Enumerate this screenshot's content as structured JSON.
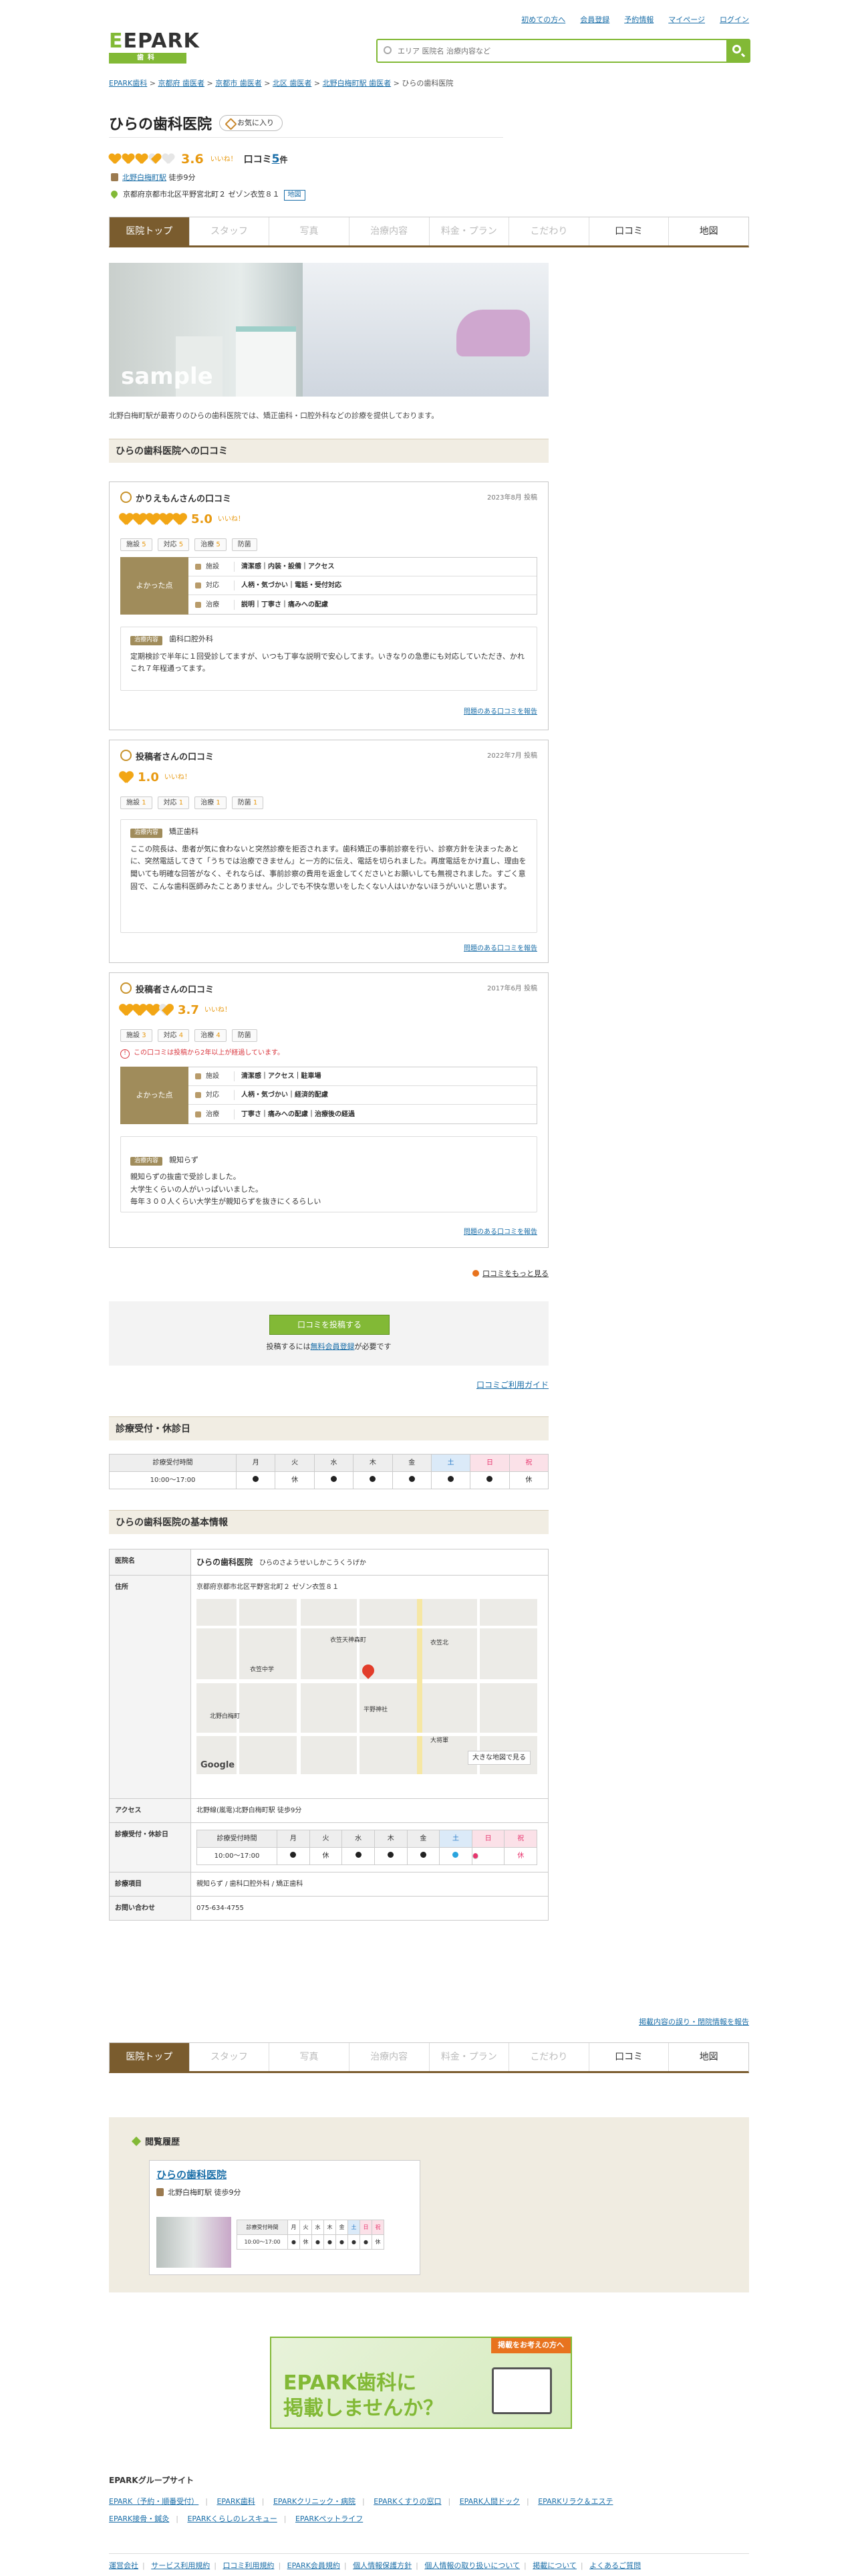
{
  "header": {
    "links": [
      "初めての方へ",
      "会員登録",
      "予約情報",
      "マイページ",
      "ログイン"
    ],
    "logo_main": "EPARK",
    "logo_sub": "歯科",
    "search_placeholder": "エリア 医院名 治療内容など"
  },
  "breadcrumb": [
    "EPARK歯科",
    "京都府 歯医者",
    "京都市 歯医者",
    "北区 歯医者",
    "北野白梅町駅 歯医者",
    "ひらの歯科医院"
  ],
  "clinic": {
    "name": "ひらの歯科医院",
    "favorite": "お気に入り",
    "rating": "3.6",
    "rating_word": "いいね！",
    "review_label": "口コミ",
    "review_count": "5",
    "review_unit": "件",
    "station": "北野白梅町駅",
    "walk": "徒歩9分",
    "address": "京都府京都市北区平野宮北町２ ゼゾン衣笠８１",
    "map_btn": "地図"
  },
  "tabs": [
    "医院トップ",
    "スタッフ",
    "写真",
    "治療内容",
    "料金・プラン",
    "こだわり",
    "口コミ",
    "地図"
  ],
  "photo_label": "sample",
  "description": "北野白梅町駅が最寄りのひらの歯科医院では、矯正歯科・口腔外科などの診療を提供しております。",
  "reviews_title": "ひらの歯科医院への口コミ",
  "reviews": [
    {
      "author": "かりえもんさんの口コミ",
      "date": "2023年8月 投稿",
      "score": "5.0",
      "word": "いいね！",
      "chips": [
        [
          "施設",
          "5"
        ],
        [
          "対応",
          "5"
        ],
        [
          "治療",
          "5"
        ],
        [
          "防菌",
          ""
        ]
      ],
      "good_label": "よかった点",
      "rows": [
        [
          "施設",
          "清潔感｜内装・設備｜アクセス"
        ],
        [
          "対応",
          "人柄・気づかい｜電話・受付対応"
        ],
        [
          "治療",
          "説明｜丁寧さ｜痛みへの配慮"
        ]
      ],
      "tag": "治療内容",
      "treat": "歯科口腔外科",
      "body": "定期検診で半年に１回受診してますが、いつも丁寧な説明で安心してます。いきなりの急患にも対応していただき、かれこれ７年程通ってます。",
      "report": "問題のある口コミを報告"
    },
    {
      "author": "投稿者さんの口コミ",
      "date": "2022年7月 投稿",
      "score": "1.0",
      "word": "いいね！",
      "chips": [
        [
          "施設",
          "1"
        ],
        [
          "対応",
          "1"
        ],
        [
          "治療",
          "1"
        ],
        [
          "防菌",
          "1"
        ]
      ],
      "tag": "治療内容",
      "treat": "矯正歯科",
      "body": "ここの院長は、患者が気に食わないと突然診療を拒否されます。歯科矯正の事前診察を行い、診察方針を決まったあとに、突然電話してきて「うちでは治療できません」と一方的に伝え、電話を切られました。再度電話をかけ直し、理由を聞いても明確な回答がなく、それならば、事前診察の費用を返金してくださいとお願いしても無視されました。すごく意固で、こんな歯科医師みたことありません。少しでも不快な思いをしたくない人はいかないほうがいいと思います。",
      "report": "問題のある口コミを報告"
    },
    {
      "author": "投稿者さんの口コミ",
      "date": "2017年6月 投稿",
      "score": "3.7",
      "word": "いいね！",
      "chips": [
        [
          "施設",
          "3"
        ],
        [
          "対応",
          "4"
        ],
        [
          "治療",
          "4"
        ],
        [
          "防菌",
          ""
        ]
      ],
      "warning": "この口コミは投稿から2年以上が経過しています。",
      "good_label": "よかった点",
      "rows": [
        [
          "施設",
          "清潔感｜アクセス｜駐車場"
        ],
        [
          "対応",
          "人柄・気づかい｜経済的配慮"
        ],
        [
          "治療",
          "丁寧さ｜痛みへの配慮｜治療後の経過"
        ]
      ],
      "tag": "治療内容",
      "treat": "親知らず",
      "body": "親知らずの抜歯で受診しました。\n大学生くらいの人がいっぱいいました。\n毎年３００人くらい大学生が親知らずを抜きにくるらしい",
      "report": "問題のある口コミを報告"
    }
  ],
  "more_reviews": "口コミをもっと見る",
  "post": {
    "button": "口コミを投稿する",
    "note_pre": "投稿するには",
    "note_link": "無料会員登録",
    "note_post": "が必要です"
  },
  "guide": "口コミご利用ガイド",
  "hours_title": "診療受付・休診日",
  "hours": {
    "head": "診療受付時間",
    "days": [
      "月",
      "火",
      "水",
      "木",
      "金",
      "土",
      "日",
      "祝"
    ],
    "time": "10:00〜17:00",
    "marks": [
      "●",
      "休",
      "●",
      "●",
      "●",
      "●",
      "●",
      "休"
    ]
  },
  "basic_title": "ひらの歯科医院の基本情報",
  "basic": {
    "k_name": "医院名",
    "name": "ひらの歯科医院",
    "kana": "ひらのさようせいしかこうくうげか",
    "k_addr": "住所",
    "addr": "京都府京都市北区平野宮北町２ ゼゾン衣笠８１",
    "map_big": "大きな地図で見る",
    "google": "Google",
    "k_access": "アクセス",
    "access": "北野線(嵐電)北野白梅町駅 徒歩9分",
    "k_hours": "診療受付・休診日",
    "k_items": "診療項目",
    "items": "親知らず / 歯科口腔外科 / 矯正歯科",
    "k_tel": "お問い合わせ",
    "tel": "075-634-4755",
    "map_labels": [
      "衣笠中学",
      "北野白梅町",
      "衣笠北",
      "平野神社",
      "大将軍",
      "衣笠天神森町"
    ]
  },
  "report_link": "掲載内容の誤り・閉院情報を報告",
  "history": {
    "title": "閲覧履歴",
    "name": "ひらの歯科医院",
    "access": "北野白梅町駅 徒歩9分",
    "head": "診療受付時間",
    "days": [
      "月",
      "火",
      "水",
      "木",
      "金",
      "土",
      "日",
      "祝"
    ],
    "time": "10:00〜17:00",
    "marks": [
      "●",
      "休",
      "●",
      "●",
      "●",
      "●",
      "●",
      "休"
    ]
  },
  "banner": {
    "tag": "掲載をお考えの方へ",
    "l1": "EPARK歯科に",
    "l2": "掲載しませんか？"
  },
  "group_title": "EPARKグループサイト",
  "group_links": [
    "EPARK（予約・順番受付）",
    "EPARK歯科",
    "EPARKクリニック・病院",
    "EPARKくすりの窓口",
    "EPARK人間ドック",
    "EPARKリラク＆エステ",
    "EPARK接骨・鍼灸",
    "EPARKくらしのレスキュー",
    "EPARKペットライフ"
  ],
  "footer_links": [
    "運営会社",
    "サービス利用規約",
    "口コミ利用規約",
    "EPARK会員規約",
    "個人情報保護方針",
    "個人情報の取り扱いについて",
    "掲載について",
    "よくあるご質問"
  ],
  "colors": {
    "brand": "#82b936",
    "tab_active": "#7a5c2e",
    "star": "#f2a615",
    "link": "#1a6ea8"
  }
}
